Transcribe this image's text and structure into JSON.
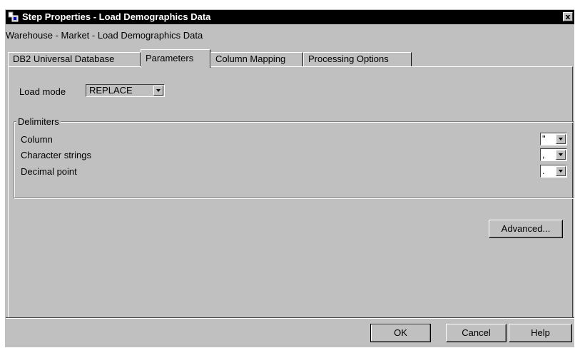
{
  "window": {
    "title": "Step Properties - Load Demographics Data",
    "icon": "step-properties-icon",
    "close_label": "x"
  },
  "breadcrumb": "Warehouse - Market - Load Demographics Data",
  "tabs": [
    {
      "label": "DB2 Universal Database",
      "active": false
    },
    {
      "label": "Parameters",
      "active": true
    },
    {
      "label": "Column Mapping",
      "active": false
    },
    {
      "label": "Processing Options",
      "active": false
    }
  ],
  "load_mode": {
    "label": "Load mode",
    "value": "REPLACE"
  },
  "delimiters": {
    "group_label": "Delimiters",
    "rows": [
      {
        "label": "Column",
        "value": "\""
      },
      {
        "label": "Character strings",
        "value": ","
      },
      {
        "label": "Decimal point",
        "value": "."
      }
    ]
  },
  "buttons": {
    "advanced": "Advanced...",
    "ok": "OK",
    "cancel": "Cancel",
    "help": "Help"
  },
  "colors": {
    "title_bar": "#000000",
    "face": "#c0c0c0"
  }
}
